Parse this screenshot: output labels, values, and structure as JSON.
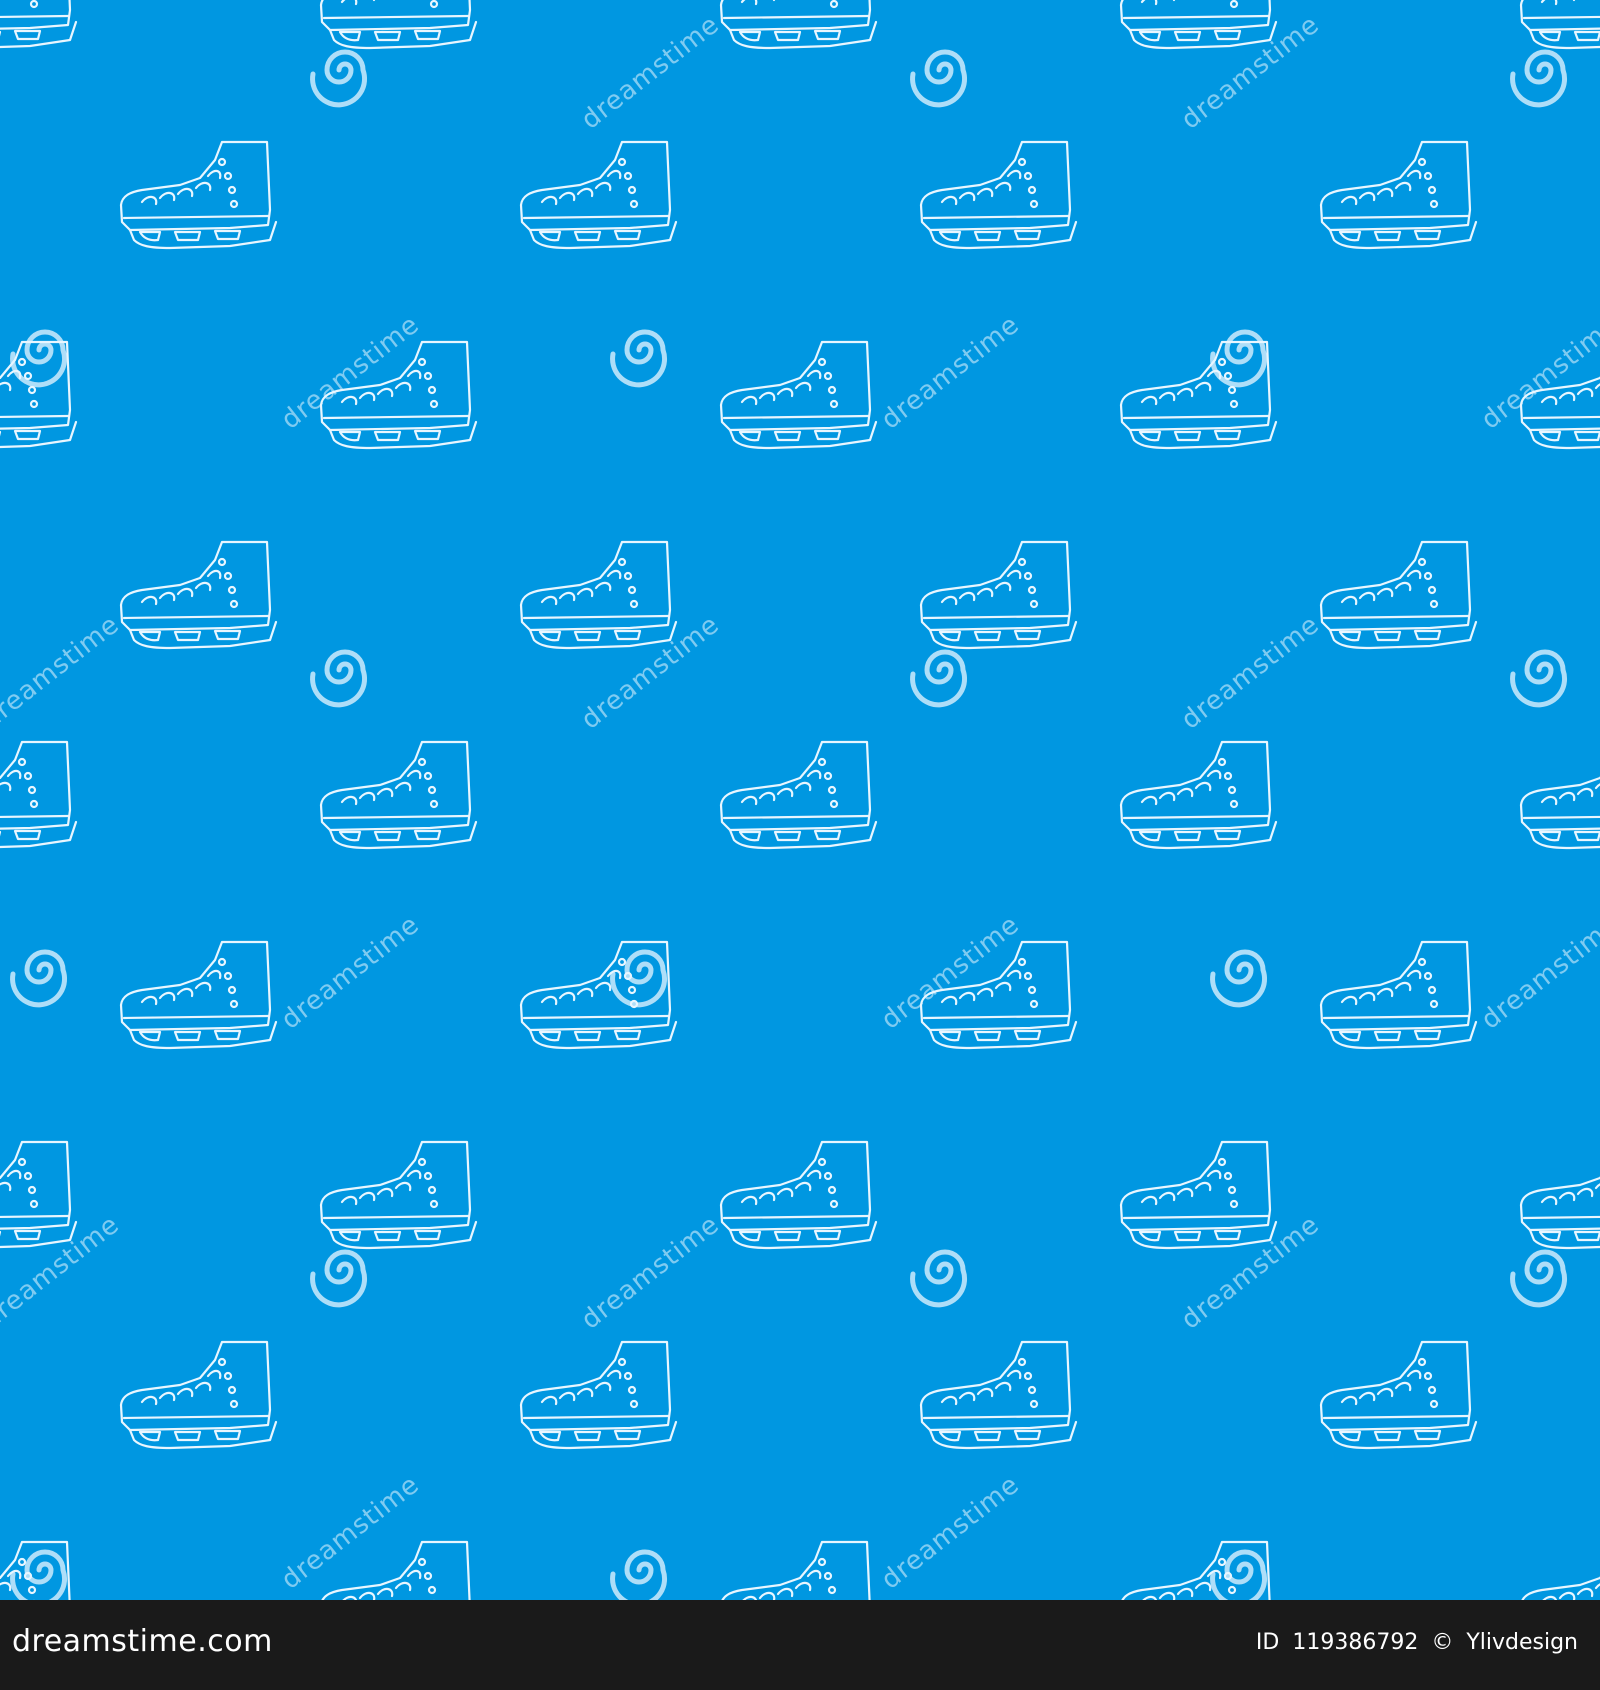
{
  "pattern": {
    "background_color": "#0097e1",
    "line_color": "#e8f6ff",
    "motif_icon": "ice-skate-icon",
    "watermark_icon": "spiral-logo-icon",
    "watermark_text": "dreamstime"
  },
  "footer": {
    "background_color": "#1a1a1a",
    "site": "dreamstime.com",
    "id_label": "ID",
    "id_number": "119386792",
    "copyright": "©",
    "author": "Ylivdesign"
  }
}
